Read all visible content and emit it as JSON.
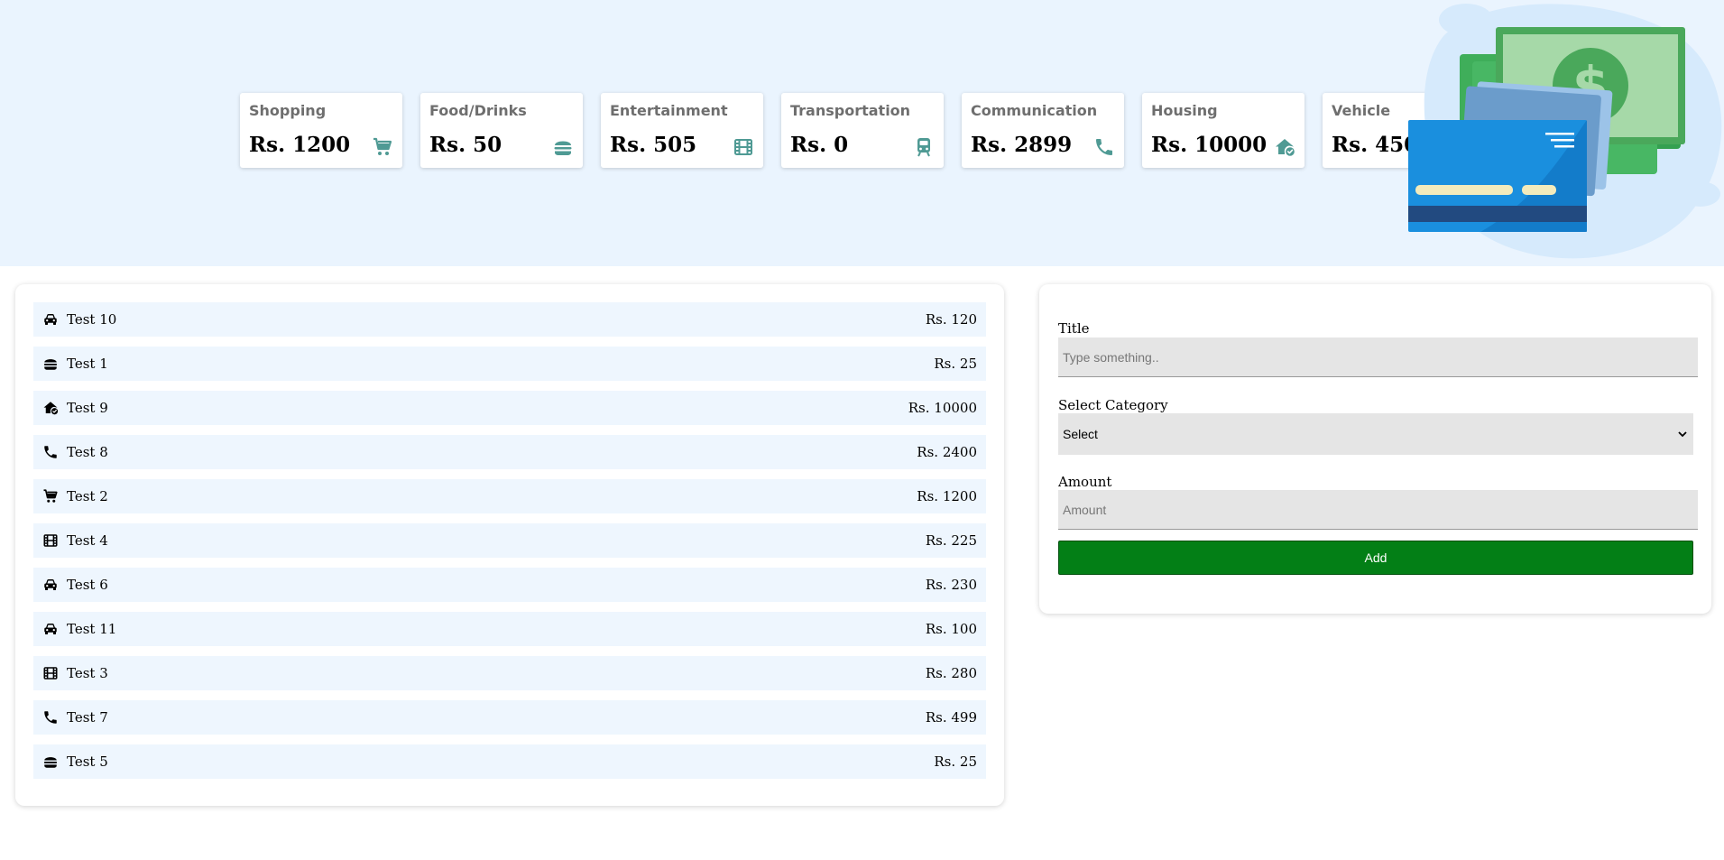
{
  "colors": {
    "accent": "#4f9a94",
    "hero_bg": "#eaf4fe",
    "add_button": "#037f16"
  },
  "summary_cards": [
    {
      "name": "Shopping",
      "amount": "Rs. 1200",
      "icon": "cart-icon"
    },
    {
      "name": "Food/Drinks",
      "amount": "Rs. 50",
      "icon": "burger-icon"
    },
    {
      "name": "Entertainment",
      "amount": "Rs. 505",
      "icon": "film-icon"
    },
    {
      "name": "Transportation",
      "amount": "Rs. 0",
      "icon": "train-icon"
    },
    {
      "name": "Communication",
      "amount": "Rs. 2899",
      "icon": "phone-icon"
    },
    {
      "name": "Housing",
      "amount": "Rs. 10000",
      "icon": "house-check-icon"
    },
    {
      "name": "Vehicle",
      "amount": "Rs. 450",
      "icon": "car-icon"
    }
  ],
  "expenses": [
    {
      "title": "Test 10",
      "amount": "Rs. 120",
      "icon": "car-icon"
    },
    {
      "title": "Test 1",
      "amount": "Rs. 25",
      "icon": "burger-icon"
    },
    {
      "title": "Test 9",
      "amount": "Rs. 10000",
      "icon": "house-check-icon"
    },
    {
      "title": "Test 8",
      "amount": "Rs. 2400",
      "icon": "phone-icon"
    },
    {
      "title": "Test 2",
      "amount": "Rs. 1200",
      "icon": "cart-icon"
    },
    {
      "title": "Test 4",
      "amount": "Rs. 225",
      "icon": "film-icon"
    },
    {
      "title": "Test 6",
      "amount": "Rs. 230",
      "icon": "car-icon"
    },
    {
      "title": "Test 11",
      "amount": "Rs. 100",
      "icon": "car-icon"
    },
    {
      "title": "Test 3",
      "amount": "Rs. 280",
      "icon": "film-icon"
    },
    {
      "title": "Test 7",
      "amount": "Rs. 499",
      "icon": "phone-icon"
    },
    {
      "title": "Test 5",
      "amount": "Rs. 25",
      "icon": "burger-icon"
    }
  ],
  "form": {
    "title_label": "Title",
    "title_placeholder": "Type something..",
    "title_value": "",
    "category_label": "Select Category",
    "category_value": "Select",
    "amount_label": "Amount",
    "amount_placeholder": "Amount",
    "amount_value": "",
    "add_label": "Add"
  }
}
